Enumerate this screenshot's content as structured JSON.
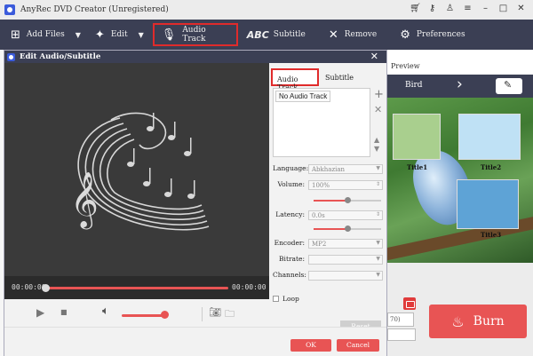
{
  "window": {
    "title": "AnyRec DVD Creator (Unregistered)",
    "icons": [
      "cart-icon",
      "key-icon",
      "user-icon",
      "menu-icon",
      "minimize-icon",
      "maximize-icon",
      "close-icon"
    ]
  },
  "toolbar": {
    "add_files": "Add Files",
    "edit": "Edit",
    "audio_track": "Audio Track",
    "subtitle": "Subtitle",
    "remove": "Remove",
    "preferences": "Preferences",
    "subtitle_icon_text": "ABC"
  },
  "background": {
    "preview_label": "Preview",
    "menu_title": "Bird",
    "thumb_labels": [
      "Title1",
      "Title2",
      "Title3"
    ],
    "burn_label": "Burn",
    "combo_value": "70)"
  },
  "dialog": {
    "title": "Edit Audio/Subtitle",
    "time_start": "00:00:00",
    "time_end": "00:00:00",
    "tabs": {
      "audio": "Audio Track",
      "subtitle": "Subtitle"
    },
    "track_list": [
      "No Audio Track"
    ],
    "fields": {
      "language_label": "Language:",
      "language_value": "Abkhazian",
      "volume_label": "Volume:",
      "volume_value": "100%",
      "latency_label": "Latency:",
      "latency_value": "0.0s",
      "encoder_label": "Encoder:",
      "encoder_value": "MP2",
      "bitrate_label": "Bitrate:",
      "bitrate_value": "",
      "channels_label": "Channels:",
      "channels_value": ""
    },
    "loop_label": "Loop",
    "reset_label": "Reset",
    "ok_label": "OK",
    "cancel_label": "Cancel",
    "playback_progress": 0.0,
    "volume_level": 0.75,
    "volume_slider": 0.5,
    "latency_slider": 0.5
  },
  "colors": {
    "toolbar_bg": "#3b3f54",
    "accent_red": "#e85454",
    "highlight_border": "#e02b2b"
  }
}
